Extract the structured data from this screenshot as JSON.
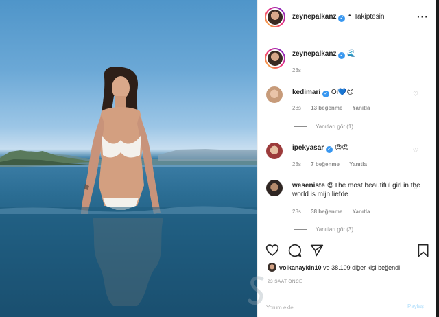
{
  "post": {
    "author": "zeynepalkanz",
    "follow_status": "Takiptesin",
    "more_icon": "more-dots-icon",
    "colors": {
      "accent": "#3897f0",
      "text": "#262626",
      "muted": "#8e8e8e",
      "post_button": "#b2dffc"
    }
  },
  "caption": {
    "author": "zeynepalkanz",
    "emoji": "🌊",
    "time": "23s"
  },
  "comments": [
    {
      "user": "kedimari",
      "text": "Oi💙😊",
      "time": "23s",
      "likes": "13 beğenme",
      "reply": "Yanıtla",
      "view_replies": "Yanıtları gör (1)"
    },
    {
      "user": "ipekyasar",
      "text": "😍😍",
      "time": "23s",
      "likes": "7 beğenme",
      "reply": "Yanıtla"
    },
    {
      "user": "weseniste",
      "text": "😍The most beautiful girl in the world is mijn liefde",
      "time": "23s",
      "likes": "38 beğenme",
      "reply": "Yanıtla",
      "view_replies": "Yanıtları gör (3)"
    }
  ],
  "actions": {
    "like_icon": "heart-icon",
    "comment_icon": "comment-icon",
    "share_icon": "share-icon",
    "save_icon": "bookmark-icon"
  },
  "likes": {
    "user": "volkanaykin10",
    "rest": "ve 38.109 diğer kişi beğendi"
  },
  "time_ago": "23 SAAT ÖNCE",
  "comment_box": {
    "placeholder": "Yorum ekle...",
    "post_label": "Paylaş"
  }
}
